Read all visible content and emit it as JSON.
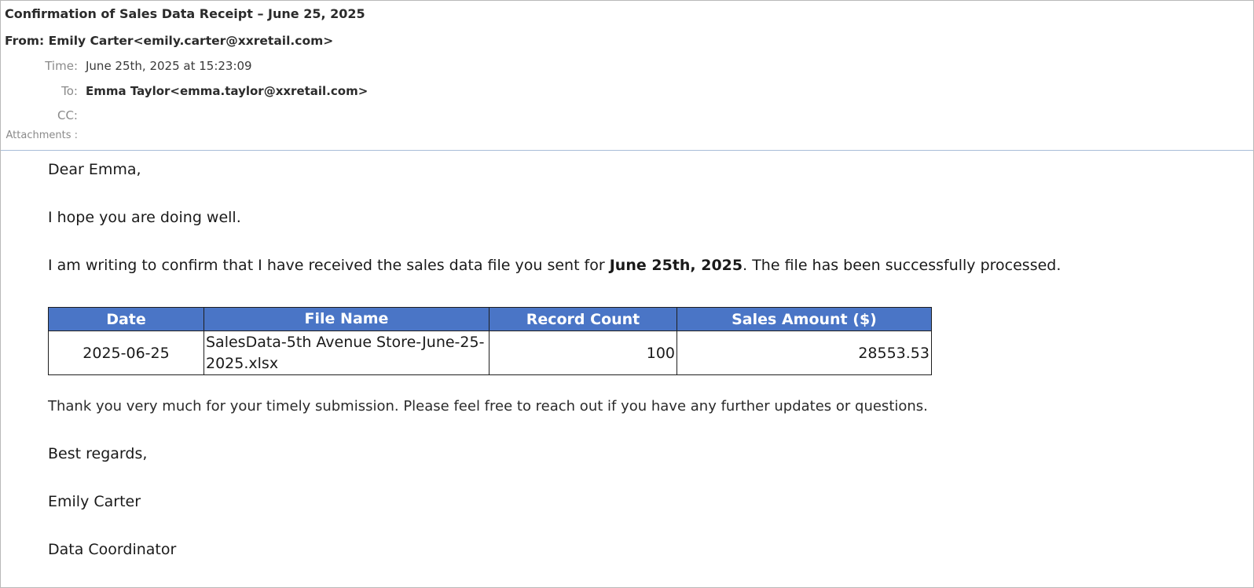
{
  "email": {
    "subject": "Confirmation of Sales Data Receipt – June 25, 2025",
    "from_label": "From:",
    "from_value": "Emily Carter<emily.carter@xxretail.com>",
    "time_label": "Time:",
    "time_value": "June 25th, 2025 at 15:23:09",
    "to_label": "To:",
    "to_value": "Emma Taylor<emma.taylor@xxretail.com>",
    "cc_label": "CC:",
    "cc_value": "",
    "attachments_label": "Attachments :"
  },
  "body": {
    "greeting": "Dear Emma,",
    "hope": "I hope you are doing well.",
    "confirm_pre": "I am writing to confirm that I have received the sales data file you sent for ",
    "confirm_bold": "June 25th, 2025",
    "confirm_post": ". The file has been successfully processed.",
    "thanks": "Thank you very much for your timely submission. Please feel free to reach out if you have any further updates or questions.",
    "regards": "Best regards,",
    "signature_name": "Emily Carter",
    "signature_title": "Data Coordinator"
  },
  "table": {
    "headers": [
      "Date",
      "File Name",
      "Record Count",
      "Sales Amount ($)"
    ],
    "rows": [
      [
        "2025-06-25",
        "SalesData-5th Avenue Store-June-25-2025.xlsx",
        "100",
        "28553.53"
      ]
    ]
  },
  "colors": {
    "table_header_bg": "#4a75c6",
    "header_divider": "#a9bdd8"
  }
}
